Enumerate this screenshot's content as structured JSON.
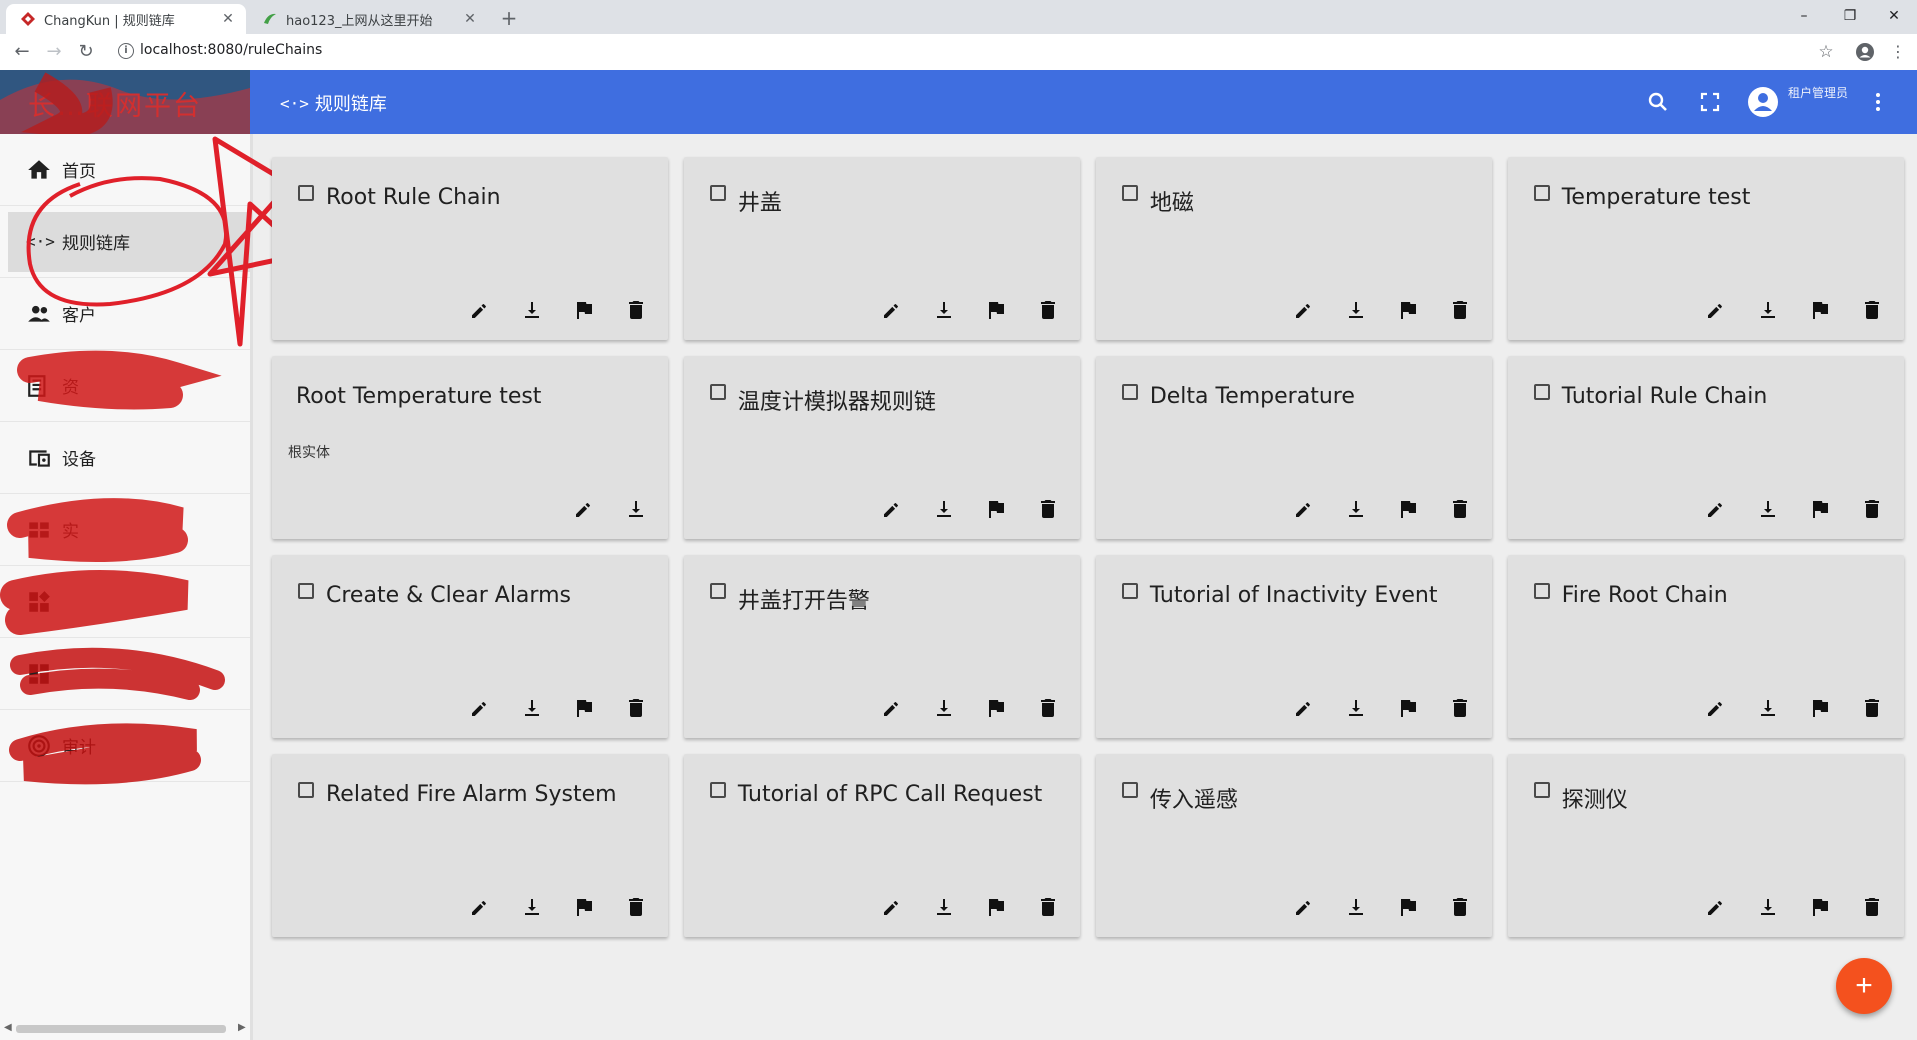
{
  "browser": {
    "tabs": [
      {
        "title": "ChangKun | 规则链库",
        "active": true
      },
      {
        "title": "hao123_上网从这里开始",
        "active": false
      }
    ],
    "new_tab": "+",
    "url": "localhost:8080/ruleChains",
    "window_controls": [
      "–",
      "❐",
      "✕"
    ]
  },
  "app": {
    "logo_text": "长…联网平台",
    "breadcrumb": "规则链库",
    "user_role": "租户管理员"
  },
  "sidebar": {
    "items": [
      {
        "label": "首页",
        "icon": "home-icon",
        "selected": false
      },
      {
        "label": "规则链库",
        "icon": "rule-chain-icon",
        "selected": true
      },
      {
        "label": "客户",
        "icon": "customers-icon",
        "selected": false
      },
      {
        "label": "资",
        "icon": "assets-icon",
        "selected": false
      },
      {
        "label": "设备",
        "icon": "devices-icon",
        "selected": false
      },
      {
        "label": "实",
        "icon": "entity-views-icon",
        "selected": false
      },
      {
        "label": "",
        "icon": "widgets-icon",
        "selected": false
      },
      {
        "label": "",
        "icon": "dashboards-icon",
        "selected": false
      },
      {
        "label": "审计",
        "icon": "audit-icon",
        "selected": false
      }
    ]
  },
  "rule_chains": [
    {
      "name": "Root Rule Chain",
      "root": false,
      "subtitle": ""
    },
    {
      "name": "井盖",
      "root": false,
      "subtitle": ""
    },
    {
      "name": "地磁",
      "root": false,
      "subtitle": ""
    },
    {
      "name": "Temperature test",
      "root": false,
      "subtitle": ""
    },
    {
      "name": "Root Temperature test",
      "root": true,
      "subtitle": "根实体"
    },
    {
      "name": "温度计模拟器规则链",
      "root": false,
      "subtitle": ""
    },
    {
      "name": "Delta Temperature",
      "root": false,
      "subtitle": ""
    },
    {
      "name": "Tutorial Rule Chain",
      "root": false,
      "subtitle": ""
    },
    {
      "name": "Create & Clear Alarms",
      "root": false,
      "subtitle": ""
    },
    {
      "name": "井盖打开告警",
      "root": false,
      "subtitle": ""
    },
    {
      "name": "Tutorial of Inactivity Event",
      "root": false,
      "subtitle": ""
    },
    {
      "name": "Fire Root Chain",
      "root": false,
      "subtitle": ""
    },
    {
      "name": "Related Fire Alarm System",
      "root": false,
      "subtitle": ""
    },
    {
      "name": "Tutorial of RPC Call Request",
      "root": false,
      "subtitle": ""
    },
    {
      "name": "传入遥感",
      "root": false,
      "subtitle": ""
    },
    {
      "name": "探测仪",
      "root": false,
      "subtitle": ""
    }
  ],
  "fab": "+",
  "colors": {
    "appbar": "#3f6ee0",
    "fab": "#f4511e",
    "annotation": "#e0202a"
  }
}
